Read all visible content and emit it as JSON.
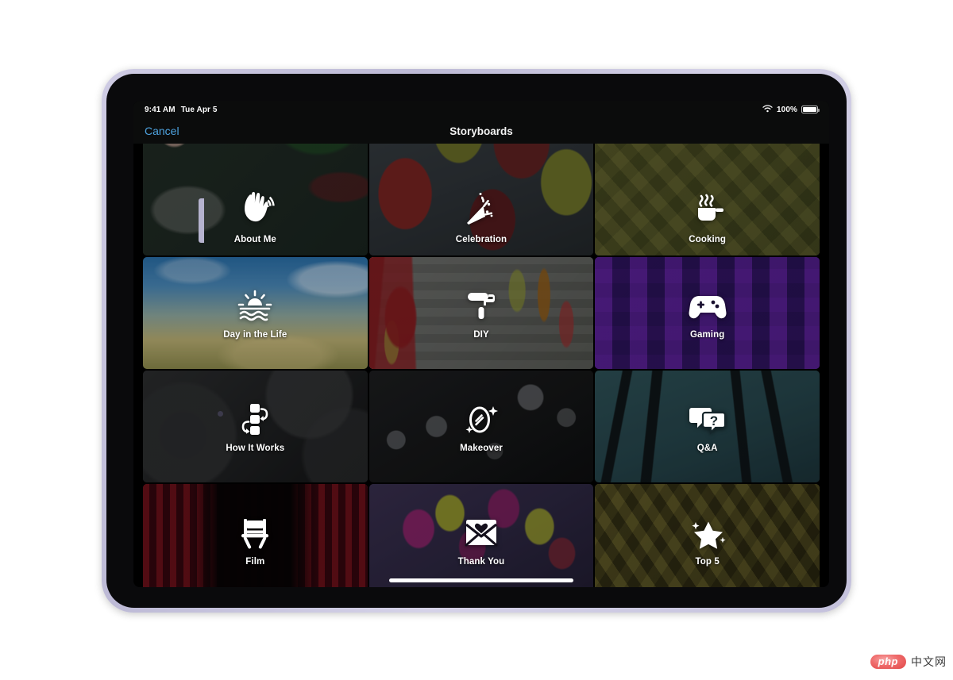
{
  "device": {
    "name": "iPad",
    "bezel_color": "#c4c1dc"
  },
  "status_bar": {
    "time": "9:41 AM",
    "date": "Tue Apr 5",
    "wifi_icon": "wifi-icon",
    "battery_percent": "100%",
    "battery_icon": "battery-full-icon"
  },
  "nav_bar": {
    "cancel_label": "Cancel",
    "title": "Storyboards"
  },
  "grid": {
    "cards": [
      {
        "id": "about-me",
        "label": "About Me",
        "icon": "waving-hand-icon",
        "bg": "bg-about-me",
        "partial": true
      },
      {
        "id": "celebration",
        "label": "Celebration",
        "icon": "party-popper-icon",
        "bg": "bg-celebration",
        "partial": true
      },
      {
        "id": "cooking",
        "label": "Cooking",
        "icon": "steaming-pot-icon",
        "bg": "bg-cooking",
        "partial": true
      },
      {
        "id": "day-life",
        "label": "Day in the Life",
        "icon": "sunrise-water-icon",
        "bg": "bg-day-life",
        "partial": false
      },
      {
        "id": "diy",
        "label": "DIY",
        "icon": "paint-roller-icon",
        "bg": "bg-diy",
        "partial": false
      },
      {
        "id": "gaming",
        "label": "Gaming",
        "icon": "gamepad-icon",
        "bg": "bg-gaming",
        "partial": false
      },
      {
        "id": "how-works",
        "label": "How It Works",
        "icon": "flowchart-icon",
        "bg": "bg-how-works",
        "partial": false
      },
      {
        "id": "makeover",
        "label": "Makeover",
        "icon": "mirror-sparkle-icon",
        "bg": "bg-makeover",
        "partial": false
      },
      {
        "id": "qa",
        "label": "Q&A",
        "icon": "speech-bubbles-question-icon",
        "bg": "bg-qa",
        "partial": false
      },
      {
        "id": "film",
        "label": "Film",
        "icon": "director-chair-icon",
        "bg": "bg-film",
        "partial": false
      },
      {
        "id": "thank-you",
        "label": "Thank You",
        "icon": "envelope-heart-icon",
        "bg": "bg-thank-you",
        "partial": false
      },
      {
        "id": "top5",
        "label": "Top 5",
        "icon": "star-sparkle-icon",
        "bg": "bg-top5",
        "partial": false
      }
    ]
  },
  "home_indicator": {
    "name": "home-indicator"
  },
  "watermark": {
    "logo_text": "php",
    "text": "中文网"
  },
  "colors": {
    "accent": "#4ea3e0",
    "screen_bg": "#000000",
    "bezel": "#c4c1dc"
  }
}
